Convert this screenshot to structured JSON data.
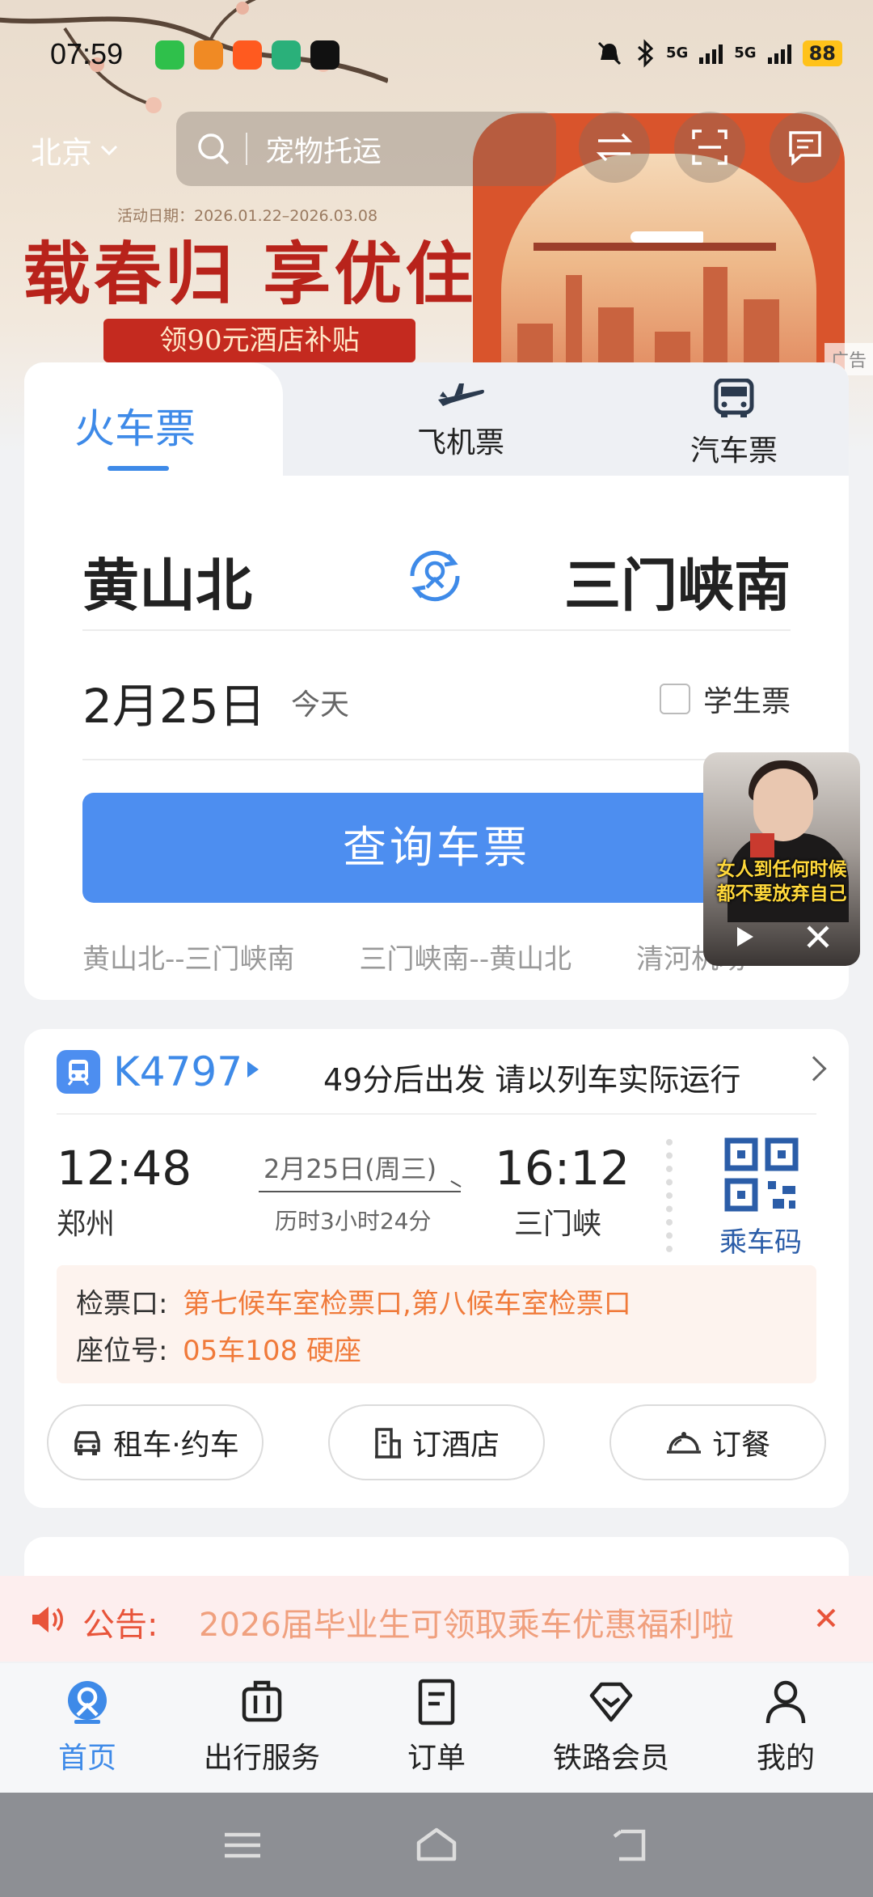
{
  "status_bar": {
    "time": "07:59",
    "signal1": "5G",
    "signal2": "5G",
    "battery": "88"
  },
  "header": {
    "city": "北京",
    "search_text": "宠物托运"
  },
  "promo": {
    "date_range": "活动日期：2026.01.22–2026.03.08",
    "title": "载春归 享优住",
    "subtitle": "领90元酒店补贴",
    "ad_tag": "广告"
  },
  "ticket": {
    "tabs": [
      {
        "label": "火车票",
        "icon": "train-icon"
      },
      {
        "label": "飞机票",
        "icon": "plane-icon"
      },
      {
        "label": "汽车票",
        "icon": "bus-icon"
      }
    ],
    "from_station": "黄山北",
    "to_station": "三门峡南",
    "date": "2月25日",
    "day_hint": "今天",
    "student_label": "学生票",
    "search_button": "查询车票",
    "history": [
      "黄山北--三门峡南",
      "三门峡南--黄山北",
      "清河机场"
    ]
  },
  "float_video": {
    "caption_line1": "女人到任何时候",
    "caption_line2": "都不要放弃自己"
  },
  "trip": {
    "train_no": "K4797",
    "depart_note": "49分后出发 请以列车实际运行",
    "dep_time": "12:48",
    "dep_station": "郑州",
    "date": "2月25日(周三)",
    "duration": "历时3小时24分",
    "arr_time": "16:12",
    "arr_station": "三门峡",
    "qr_label": "乘车码",
    "gate_label": "检票口:",
    "gate_value": "第七候车室检票口,第八候车室检票口",
    "seat_label": "座位号:",
    "seat_value": "05车108 硬座",
    "services": [
      "租车·约车",
      "订酒店",
      "订餐"
    ]
  },
  "notice": {
    "label": "公告:",
    "text": "2026届毕业生可领取乘车优惠福利啦"
  },
  "bottom_nav": [
    {
      "label": "首页",
      "icon": "home-icon",
      "active": true
    },
    {
      "label": "出行服务",
      "icon": "luggage-icon"
    },
    {
      "label": "订单",
      "icon": "order-icon"
    },
    {
      "label": "铁路会员",
      "icon": "diamond-icon"
    },
    {
      "label": "我的",
      "icon": "user-icon"
    }
  ],
  "colors": {
    "accent": "#3e8ae8",
    "button": "#4d8ef0",
    "orange": "#f07a3a",
    "promo_red": "#b8231b"
  }
}
